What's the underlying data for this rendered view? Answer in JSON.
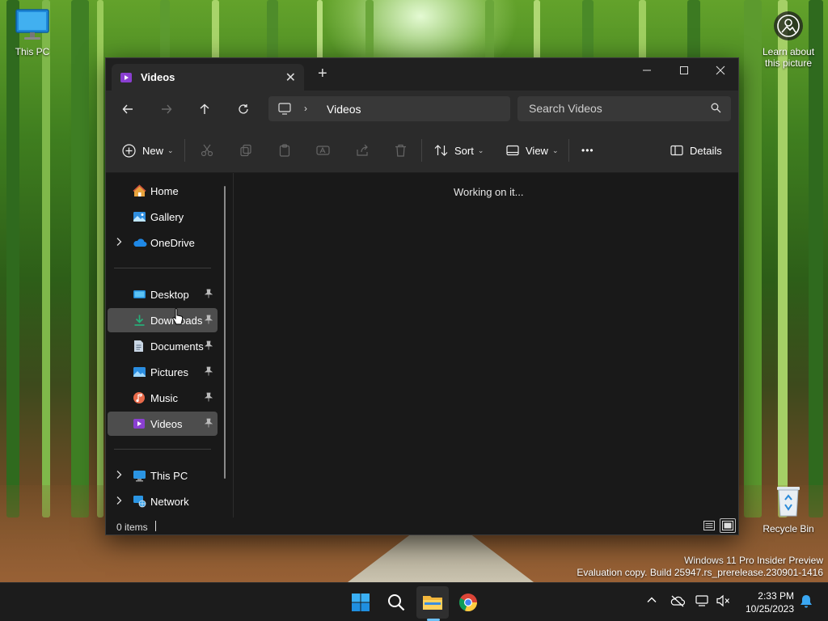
{
  "desktop": {
    "icons": [
      {
        "label": "This PC"
      },
      {
        "label": "Learn about this picture"
      },
      {
        "label": "Recycle Bin"
      }
    ],
    "watermark": {
      "line1": "Windows 11 Pro Insider Preview",
      "line2": "Evaluation copy. Build 25947.rs_prerelease.230901-1416"
    }
  },
  "window": {
    "tab": {
      "title": "Videos",
      "close": "✕"
    },
    "new_tab": "+",
    "controls": {
      "minimize": "—",
      "maximize": "☐",
      "close": "✕"
    },
    "address": {
      "breadcrumb": "Videos",
      "separator": "›"
    },
    "search": {
      "placeholder": "Search Videos"
    },
    "commandbar": {
      "new_label": "New",
      "sort_label": "Sort",
      "view_label": "View",
      "more_label": "•••",
      "details_label": "Details"
    },
    "sidebar": {
      "items": [
        {
          "label": "Home",
          "icon": "home-icon",
          "expandable": false,
          "pinned": false
        },
        {
          "label": "Gallery",
          "icon": "gallery-icon",
          "expandable": false,
          "pinned": false
        },
        {
          "label": "OneDrive",
          "icon": "onedrive-icon",
          "expandable": true,
          "pinned": false
        },
        {
          "label": "Desktop",
          "icon": "desktop-folder-icon",
          "expandable": false,
          "pinned": true
        },
        {
          "label": "Downloads",
          "icon": "downloads-icon",
          "expandable": false,
          "pinned": true
        },
        {
          "label": "Documents",
          "icon": "documents-icon",
          "expandable": false,
          "pinned": true
        },
        {
          "label": "Pictures",
          "icon": "pictures-icon",
          "expandable": false,
          "pinned": true
        },
        {
          "label": "Music",
          "icon": "music-icon",
          "expandable": false,
          "pinned": true
        },
        {
          "label": "Videos",
          "icon": "videos-icon",
          "expandable": false,
          "pinned": true,
          "selected": true
        },
        {
          "label": "This PC",
          "icon": "this-pc-icon",
          "expandable": true,
          "pinned": false
        },
        {
          "label": "Network",
          "icon": "network-icon",
          "expandable": true,
          "pinned": false
        }
      ]
    },
    "content": {
      "message": "Working on it..."
    },
    "status": {
      "item_count": "0 items"
    }
  },
  "taskbar": {
    "clock": {
      "time": "2:33 PM",
      "date": "10/25/2023"
    }
  },
  "colors": {
    "accent": "#6cc0f7",
    "window_bg": "#191919",
    "toolbar_bg": "#2b2b2b",
    "selected_nav": "#4d4d4d"
  }
}
